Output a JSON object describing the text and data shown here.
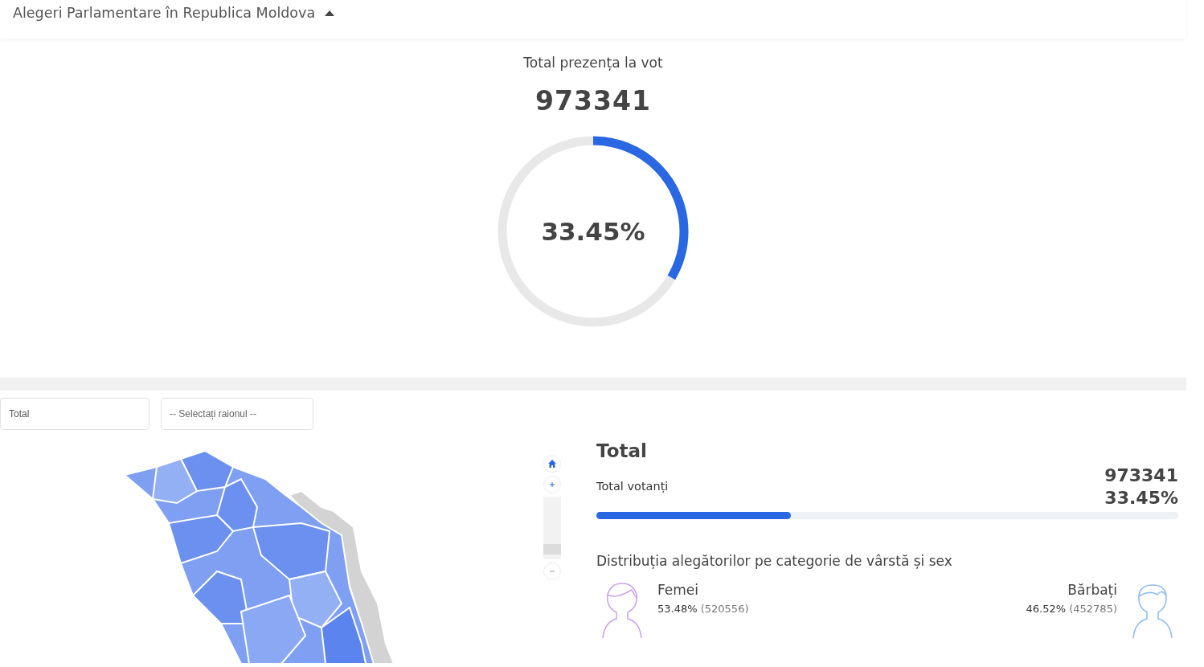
{
  "header": {
    "title": "Alegeri Parlamentare în Republica Moldova",
    "expanded": true
  },
  "turnout": {
    "title": "Total prezența la vot",
    "total": "973341",
    "level": 0.3345,
    "percent": "33.45%"
  },
  "filters": [
    {
      "value": "Total"
    },
    {
      "placeholder": "-- Selectați raionul --"
    }
  ],
  "map_zoom": {
    "level": 0.1
  },
  "stats": {
    "title": "Total",
    "label": "Total votanți",
    "total": "973341",
    "percent": "33.45%",
    "level": 0.3345,
    "distribution_title": "Distribuția alegătorilor pe categorie de vârstă și sex",
    "groups": [
      {
        "kind": "female",
        "label": "Femei",
        "percent": "53.48%",
        "count": "(520556)"
      },
      {
        "kind": "male",
        "label": "Bărbați",
        "percent": "46.52%",
        "count": "(452785)"
      }
    ]
  }
}
